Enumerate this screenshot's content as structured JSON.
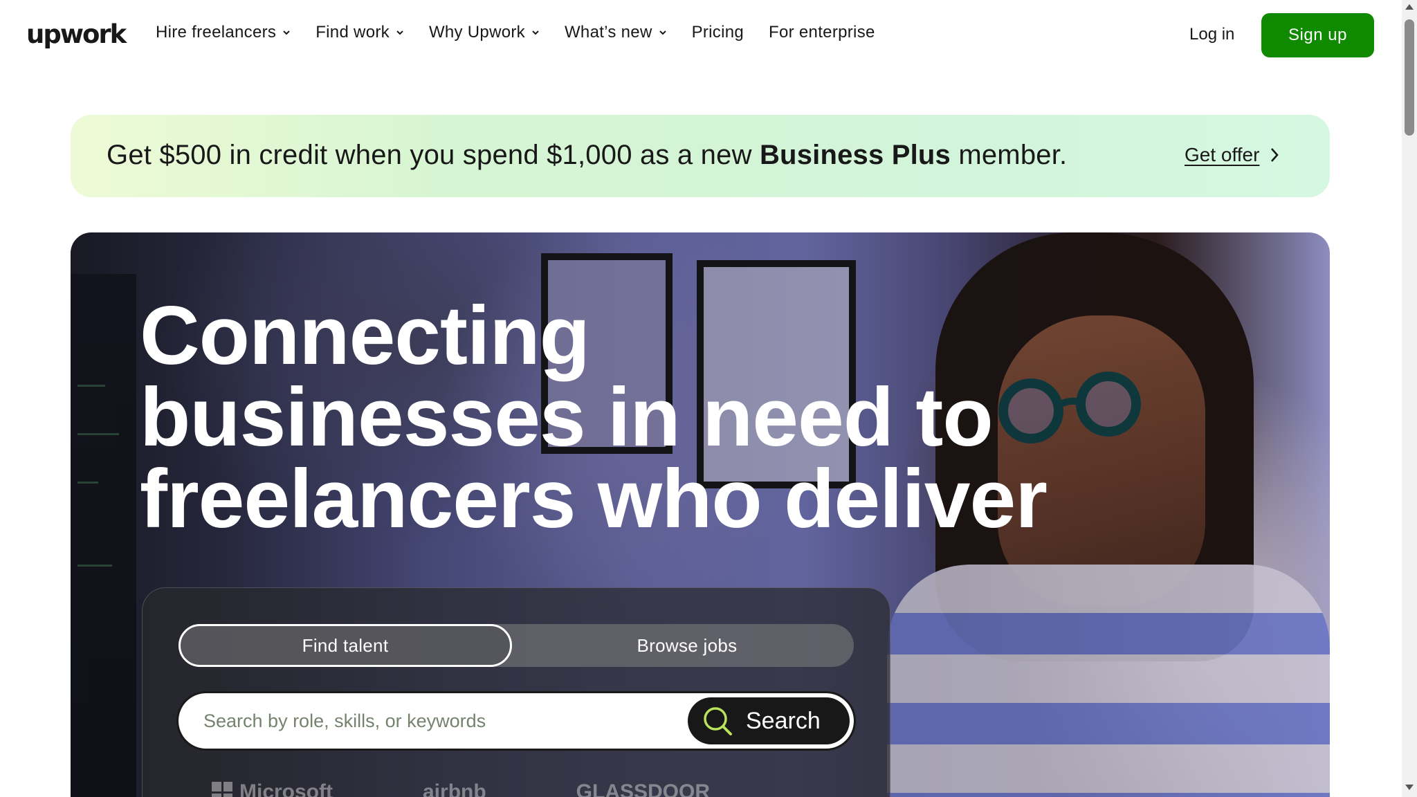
{
  "nav": {
    "logo": "upwork",
    "items": [
      {
        "label": "Hire freelancers",
        "dropdown": true
      },
      {
        "label": "Find work",
        "dropdown": true
      },
      {
        "label": "Why Upwork",
        "dropdown": true
      },
      {
        "label": "What’s new",
        "dropdown": true
      },
      {
        "label": "Pricing",
        "dropdown": false
      },
      {
        "label": "For enterprise",
        "dropdown": false
      }
    ],
    "login_label": "Log in",
    "signup_label": "Sign up"
  },
  "promo": {
    "text_before": "Get $500 in credit when you spend $1,000 as a new ",
    "text_bold": "Business Plus",
    "text_after": " member.",
    "cta_label": "Get offer"
  },
  "hero": {
    "headline_lines": [
      "Connecting",
      "businesses in need to",
      "freelancers who deliver"
    ],
    "tabs": {
      "find_talent": "Find talent",
      "browse_jobs": "Browse jobs",
      "active": "find_talent"
    },
    "search": {
      "placeholder": "Search by role, skills, or keywords",
      "value": "",
      "button_label": "Search"
    },
    "trusted_logos": [
      "Microsoft",
      "airbnb",
      "GLASSDOOR"
    ]
  },
  "colors": {
    "brand_green": "#108a00",
    "text": "#181818",
    "promo_bg_start": "#eefad6",
    "promo_bg_end": "#d6f8e2",
    "search_icon": "#b8e35a"
  },
  "icons": {
    "nav_dropdown": "chevron-down-icon",
    "promo_cta": "chevron-right-icon",
    "search": "search-icon"
  }
}
